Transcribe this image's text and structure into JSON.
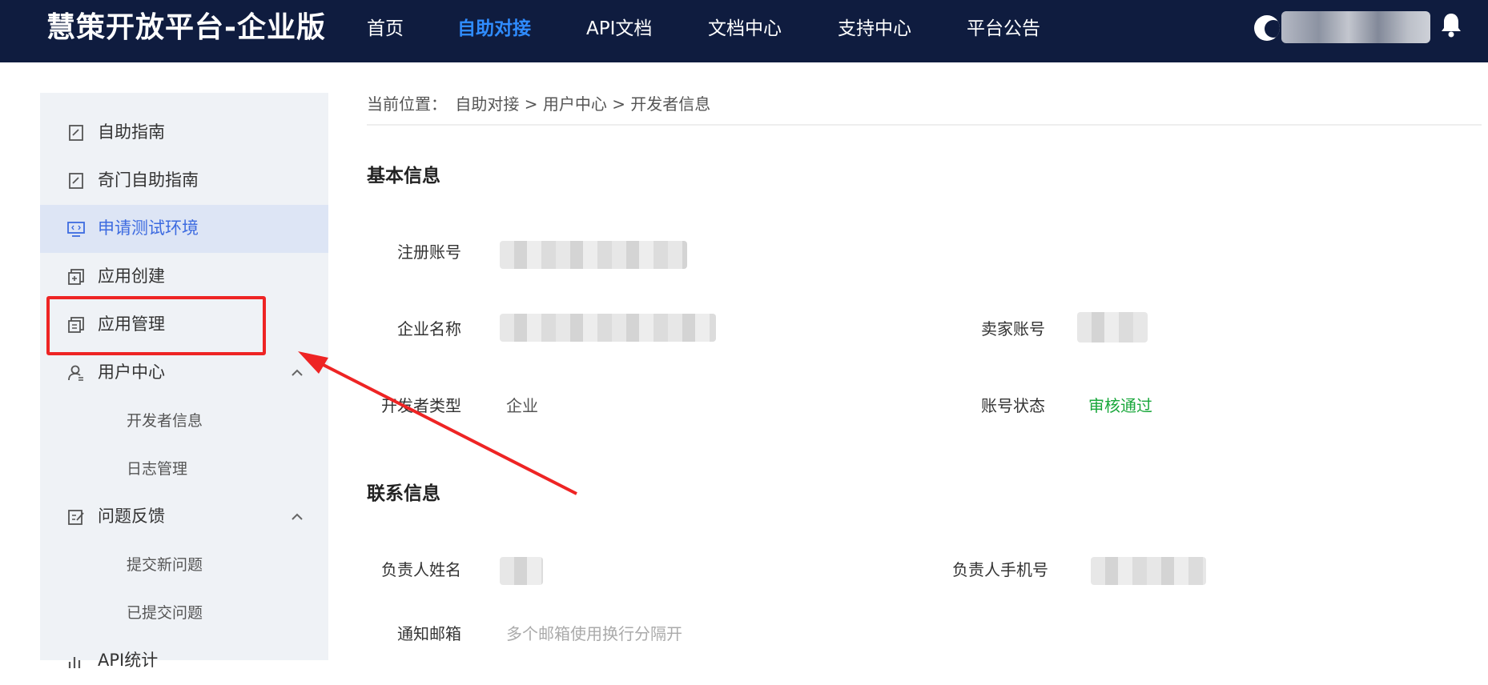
{
  "header": {
    "brand": "慧策开放平台-企业版",
    "nav": [
      {
        "label": "首页",
        "active": false
      },
      {
        "label": "自助对接",
        "active": true
      },
      {
        "label": "API文档",
        "active": false
      },
      {
        "label": "文档中心",
        "active": false
      },
      {
        "label": "支持中心",
        "active": false
      },
      {
        "label": "平台公告",
        "active": false
      }
    ],
    "icons": {
      "avatar": "user-avatar",
      "bell": "bell-icon"
    }
  },
  "sidebar": {
    "items": [
      {
        "label": "自助指南",
        "icon": "guide-icon"
      },
      {
        "label": "奇门自助指南",
        "icon": "guide-icon"
      },
      {
        "label": "申请测试环境",
        "icon": "monitor-code-icon",
        "active": true
      },
      {
        "label": "应用创建",
        "icon": "add-app-icon"
      },
      {
        "label": "应用管理",
        "icon": "manage-app-icon"
      },
      {
        "label": "用户中心",
        "icon": "user-icon",
        "expanded": true
      },
      {
        "label": "开发者信息",
        "sub": true
      },
      {
        "label": "日志管理",
        "sub": true
      },
      {
        "label": "问题反馈",
        "icon": "feedback-icon",
        "expanded": true
      },
      {
        "label": "提交新问题",
        "sub": true
      },
      {
        "label": "已提交问题",
        "sub": true
      },
      {
        "label": "API统计",
        "icon": "chart-icon"
      }
    ]
  },
  "breadcrumb": {
    "prefix": "当前位置：",
    "path": "自助对接 > 用户中心 > 开发者信息"
  },
  "basic_info": {
    "title": "基本信息",
    "register_account_label": "注册账号",
    "company_name_label": "企业名称",
    "seller_account_label": "卖家账号",
    "developer_type_label": "开发者类型",
    "developer_type_value": "企业",
    "account_status_label": "账号状态",
    "account_status_value": "审核通过",
    "status_color": "#1aa83c"
  },
  "contact_info": {
    "title": "联系信息",
    "person_name_label": "负责人姓名",
    "person_phone_label": "负责人手机号",
    "email_label": "通知邮箱",
    "email_placeholder": "多个邮箱使用换行分隔开"
  },
  "annotation": {
    "highlight_color": "#ee2424"
  }
}
